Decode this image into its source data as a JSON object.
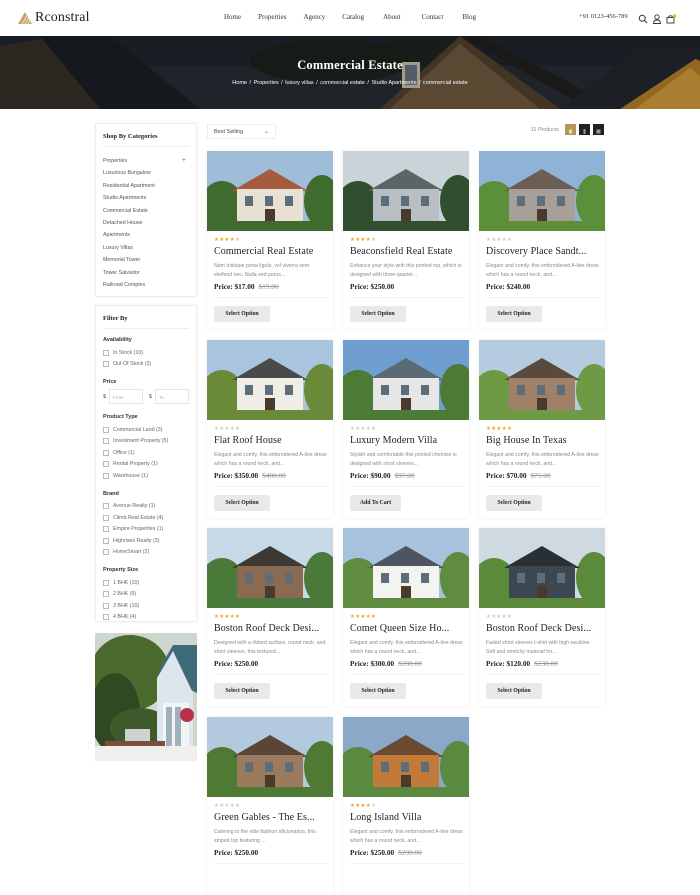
{
  "header": {
    "logo_text": "Rconstral",
    "nav": [
      "Home",
      "Properties",
      "Agency",
      "Catalog",
      "About",
      "Contact",
      "Blog"
    ],
    "phone": "+91 0123-456-789",
    "icons": [
      "search-icon",
      "user-icon",
      "cart-icon"
    ],
    "cart_count": "0"
  },
  "hero": {
    "title": "Commercial Estate",
    "breadcrumbs": [
      "Home",
      "Properties",
      "luxury villas",
      "commercial estate",
      "Studio Apartments",
      "commercial estate"
    ]
  },
  "sidebar": {
    "categories_title": "Shop By Categories",
    "categories": [
      "Properties",
      "Luxurious Bungalow",
      "Residential Apartment",
      "Studio Apartments",
      "Commercial Estate",
      "Detached House",
      "Apartments",
      "Luxury Villas",
      "Memorial Tower",
      "Tower Salvador",
      "Railroad Complex"
    ],
    "filter_title": "Filter By",
    "availability": {
      "label": "Availability",
      "options": [
        "In Stock (10)",
        "Out Of Stock (3)"
      ]
    },
    "price": {
      "label": "Price",
      "currency": "$",
      "from_placeholder": "From",
      "to_placeholder": "To"
    },
    "product_type": {
      "label": "Product Type",
      "options": [
        "Commercial Land (3)",
        "Investment Property (5)",
        "Office (1)",
        "Rental Property (1)",
        "Warehouse (1)"
      ]
    },
    "brand": {
      "label": "Brand",
      "options": [
        "Avenue Realty (1)",
        "Climb Real Estate (4)",
        "Empire Properties (1)",
        "Highrises Realty (3)",
        "HomeSmart (2)"
      ]
    },
    "property_size": {
      "label": "Property Size",
      "options": [
        "1 BHK (10)",
        "2 BHK (9)",
        "3 BHK (10)",
        "4 BHK (4)"
      ]
    }
  },
  "toolbar": {
    "sort_value": "Best Selling",
    "product_count": "11 Products",
    "accent": "#b8955a"
  },
  "products": [
    {
      "title": "Commercial Real Estate",
      "rating": 4,
      "desc": "Nam tristique porta ligula, vel viverra sem eleifend nec. Nulla sed purus...",
      "price": "Price: $17.00",
      "old_price": "$19.00",
      "button": "Select Option"
    },
    {
      "title": "Beaconsfield Real Estate",
      "rating": 4,
      "desc": "Enhance your style with this printed top, which is designed with three-quarter...",
      "price": "Price: $250.00",
      "old_price": "",
      "button": "Select Option"
    },
    {
      "title": "Discovery Place Sandt...",
      "rating": 0,
      "desc": "Elegant and comfy, this embroidered A-line dress which has a round neck, and...",
      "price": "Price: $240.00",
      "old_price": "",
      "button": "Select Option"
    },
    {
      "title": "Flat Roof House",
      "rating": 0,
      "desc": "Elegant and comfy, this embroidered A-line dress which has a round neck, and...",
      "price": "Price: $350.00",
      "old_price": "$400.00",
      "button": "Select Option"
    },
    {
      "title": "Luxury Modern Villa",
      "rating": 0,
      "desc": "Stylish and comfortable this printed chemise is designed with short sleeves...",
      "price": "Price: $90.00",
      "old_price": "$97.00",
      "button": "Add To Cart"
    },
    {
      "title": "Big House In Texas",
      "rating": 5,
      "desc": "Elegant and comfy, this embroidered A-line dress which has a round neck, and...",
      "price": "Price: $70.00",
      "old_price": "$75.00",
      "button": "Select Option"
    },
    {
      "title": "Boston Roof Deck Desi...",
      "rating": 5,
      "desc": "Designed with a ribbed surface, round neck, and short sleeves, this textured...",
      "price": "Price: $250.00",
      "old_price": "",
      "button": "Select Option"
    },
    {
      "title": "Comet Queen Size Ho...",
      "rating": 5,
      "desc": "Elegant and comfy, this embroidered A-line dress which has a round neck, and...",
      "price": "Price: $300.00",
      "old_price": "$390.00",
      "button": "Select Option"
    },
    {
      "title": "Boston Roof Deck Desi...",
      "rating": 0,
      "desc": "Faded short sleeves t-shirt with high neckline. Soft and stretchy material for...",
      "price": "Price: $120.00",
      "old_price": "$230.00",
      "button": "Select Option"
    },
    {
      "title": "Green Gables - The Es...",
      "rating": 0,
      "desc": "Catering to the elite fashion aficionados, this striped top featuring ...",
      "price": "Price: $250.00",
      "old_price": "",
      "button": ""
    },
    {
      "title": "Long Island Villa",
      "rating": 4,
      "desc": "Elegant and comfy, this embroidered A-line dress which has a round neck, and...",
      "price": "Price: $250.00",
      "old_price": "$290.00",
      "button": ""
    }
  ]
}
